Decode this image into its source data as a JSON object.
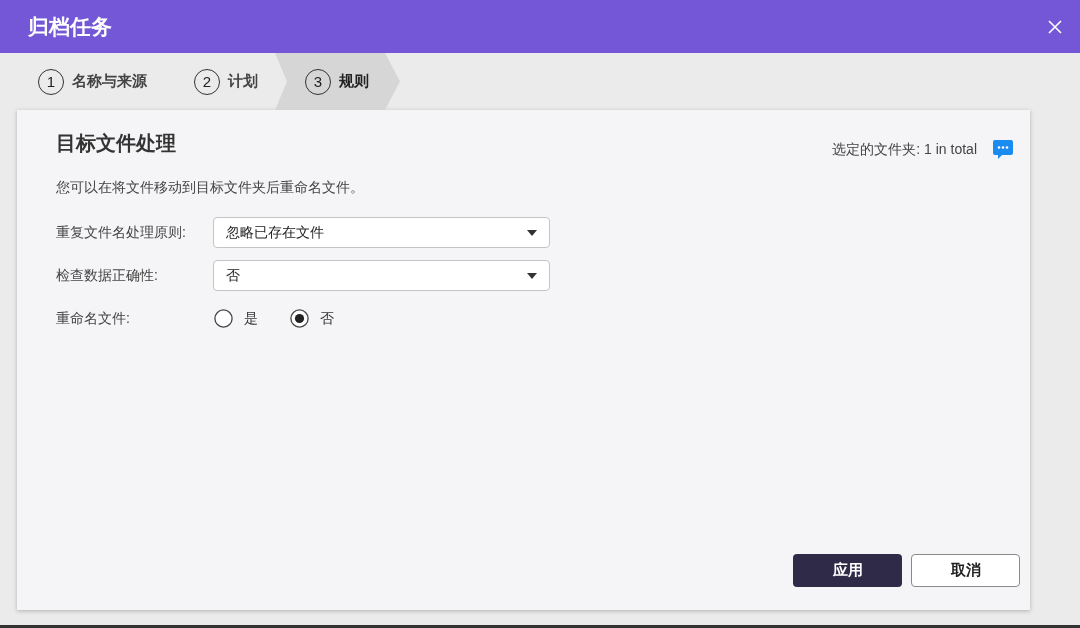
{
  "window": {
    "title": "归档任务"
  },
  "steps": [
    {
      "number": "1",
      "label": "名称与来源",
      "selected": false
    },
    {
      "number": "2",
      "label": "计划",
      "selected": false
    },
    {
      "number": "3",
      "label": "规则",
      "selected": true
    }
  ],
  "section": {
    "title": "目标文件处理",
    "selection_summary": "选定的文件夹: 1 in total",
    "description": "您可以在将文件移动到目标文件夹后重命名文件。"
  },
  "fields": [
    {
      "kind": "select",
      "label": "重复文件名处理原则:",
      "value": "忽略已存在文件"
    },
    {
      "kind": "select",
      "label": "检查数据正确性:",
      "value": "否"
    },
    {
      "kind": "radio",
      "label": "重命名文件:",
      "options": [
        {
          "label": "是",
          "selected": false
        },
        {
          "label": "否",
          "selected": true
        }
      ]
    }
  ],
  "buttons": [
    {
      "label": "应用",
      "kind": "primary"
    },
    {
      "label": "取消",
      "kind": "secondary"
    }
  ]
}
